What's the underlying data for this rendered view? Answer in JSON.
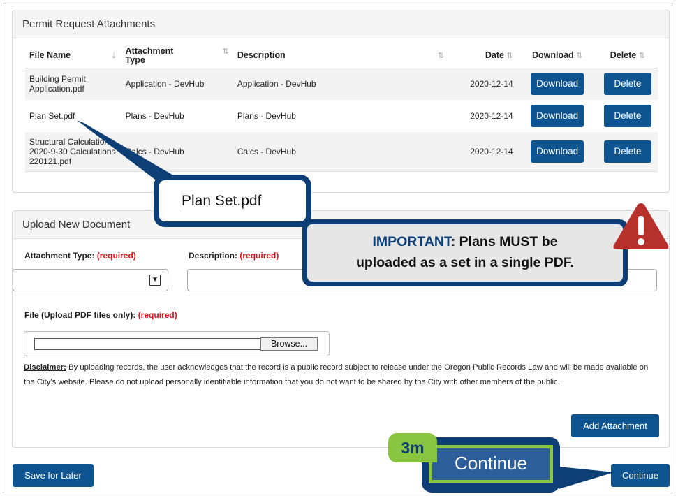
{
  "attachments_panel": {
    "title": "Permit Request Attachments",
    "columns": [
      "File Name",
      "Attachment Type",
      "Description",
      "Date",
      "Download",
      "Delete"
    ],
    "rows": [
      {
        "file": "Building Permit Application.pdf",
        "type": "Application - DevHub",
        "description": "Application - DevHub",
        "date": "2020-12-14",
        "download": "Download",
        "delete": "Delete"
      },
      {
        "file": "Plan Set.pdf",
        "type": "Plans - DevHub",
        "description": "Plans - DevHub",
        "date": "2020-12-14",
        "download": "Download",
        "delete": "Delete"
      },
      {
        "file": "Structural Calculations 2020-9-30 Calculations 220121.pdf",
        "type": "Calcs - DevHub",
        "description": "Calcs - DevHub",
        "date": "2020-12-14",
        "download": "Download",
        "delete": "Delete"
      }
    ]
  },
  "upload_panel": {
    "title": "Upload New Document",
    "attachment_type_label": "Attachment Type:",
    "description_label": "Description:",
    "required": "(required)",
    "attachment_type_value": "",
    "description_value": "",
    "file_label": "File (Upload PDF files only):",
    "browse_label": "Browse...",
    "disclaimer_title": "Disclaimer:",
    "disclaimer_text": " By uploading records, the user acknowledges that the record is a public record subject to release under the Oregon Public Records Law and will be made available on the City’s website. Please do not upload personally identifiable information that you do not want to be shared by the City with other members of the public.",
    "add_attachment_label": "Add Attachment"
  },
  "footer": {
    "save_label": "Save for Later",
    "continue_label": "Continue"
  },
  "annotations": {
    "file_callout": "Plan Set.pdf",
    "important_word": "IMPORTANT",
    "important_line1": ": Plans MUST be",
    "important_line2": "uploaded as a set in a single PDF.",
    "step_badge": "3m",
    "continue_callout": "Continue"
  },
  "colors": {
    "button_blue": "#0d5491",
    "callout_navy": "#0d3f76",
    "highlight_green": "#8ac542",
    "required_red": "#e0131b",
    "warning_red": "#b7312c"
  }
}
